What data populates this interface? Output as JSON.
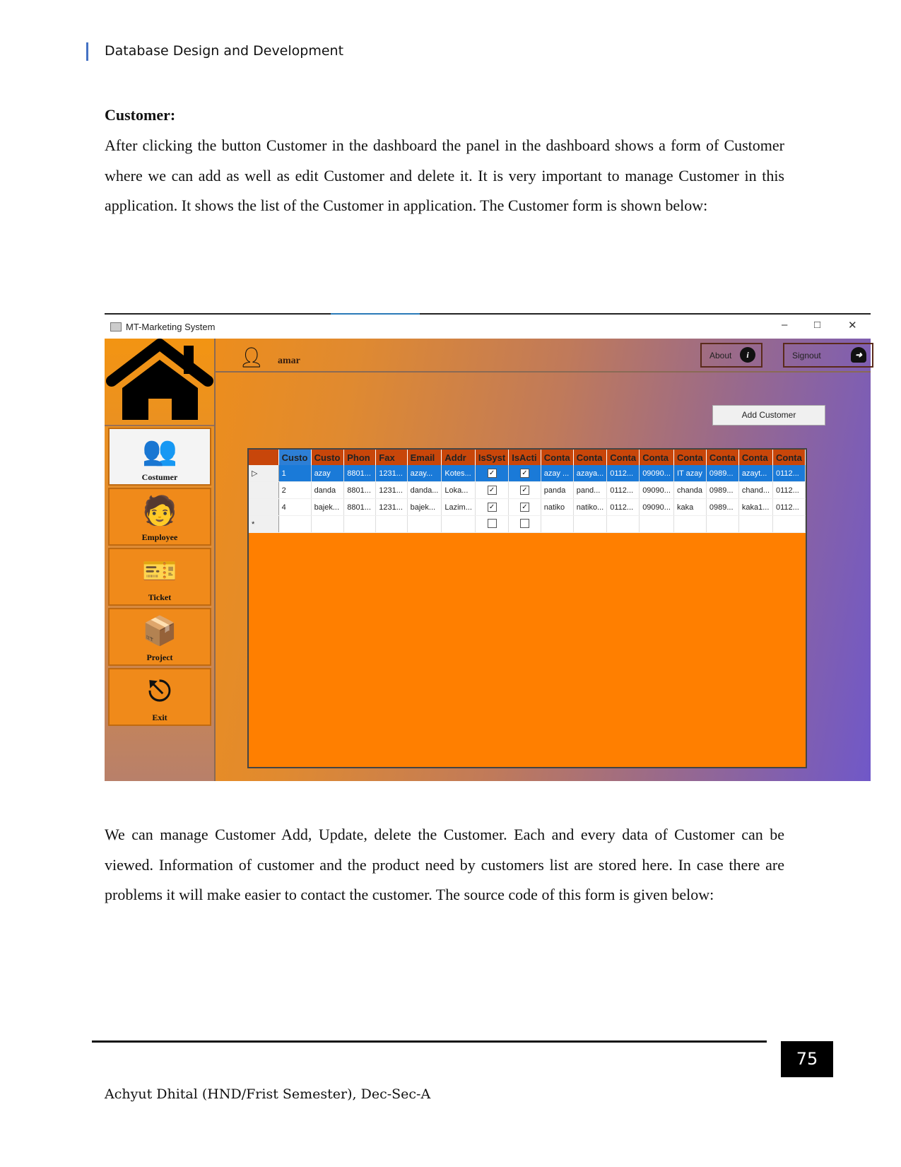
{
  "header": {
    "running_title": "Database Design and Development"
  },
  "section": {
    "heading": "Customer:",
    "intro": "After clicking the button Customer in the dashboard the panel in the dashboard shows a form of Customer where we can add as well as edit Customer and delete it. It is very important to manage Customer in this application. It shows the list of the Customer in application. The Customer form is shown below:",
    "outro": "We can manage Customer Add, Update, delete the Customer. Each and every data of Customer can be viewed. Information of customer and the product need by customers list are stored here. In case there are problems it will make easier to contact the customer. The source code of this form is given below:"
  },
  "app": {
    "window_title": "MT-Marketing System",
    "username": "amar",
    "about_label": "About",
    "signout_label": "Signout",
    "add_customer_label": "Add Customer",
    "nav": [
      {
        "label": "Costumer",
        "icon": "customers-icon",
        "active": true
      },
      {
        "label": "Employee",
        "icon": "employee-icon"
      },
      {
        "label": "Ticket",
        "icon": "ticket-icon"
      },
      {
        "label": "Project",
        "icon": "box-icon"
      },
      {
        "label": "Exit",
        "icon": "exit-icon"
      }
    ],
    "grid": {
      "columns": [
        "Custo",
        "Custo",
        "Phon",
        "Fax",
        "Email",
        "Addr",
        "IsSyst",
        "IsActi",
        "Conta",
        "Conta",
        "Conta",
        "Conta",
        "Conta",
        "Conta",
        "Conta",
        "Conta"
      ],
      "rows": [
        [
          "1",
          "azay",
          "8801...",
          "1231...",
          "azay...",
          "Kotes...",
          true,
          true,
          "azay ...",
          "azaya...",
          "0112...",
          "09090...",
          "IT azay",
          "0989...",
          "azayt...",
          "0112..."
        ],
        [
          "2",
          "danda",
          "8801...",
          "1231...",
          "danda...",
          "Loka...",
          true,
          true,
          "panda",
          "pand...",
          "0112...",
          "09090...",
          "chanda",
          "0989...",
          "chand...",
          "0112..."
        ],
        [
          "4",
          "bajek...",
          "8801...",
          "1231...",
          "bajek...",
          "Lazim...",
          true,
          true,
          "natiko",
          "natiko...",
          "0112...",
          "09090...",
          "kaka",
          "0989...",
          "kaka1...",
          "0112..."
        ]
      ],
      "new_row": [
        "",
        "",
        "",
        "",
        "",
        "",
        false,
        false,
        "",
        "",
        "",
        "",
        "",
        "",
        "",
        ""
      ]
    },
    "colors": {
      "accent_orange": "#ff7f00",
      "selection_blue": "#1a7ad8",
      "header_red": "#c8460a"
    }
  },
  "footer": {
    "page_number": "75",
    "author": "Achyut Dhital (HND/Frist Semester), Dec-Sec-A"
  }
}
